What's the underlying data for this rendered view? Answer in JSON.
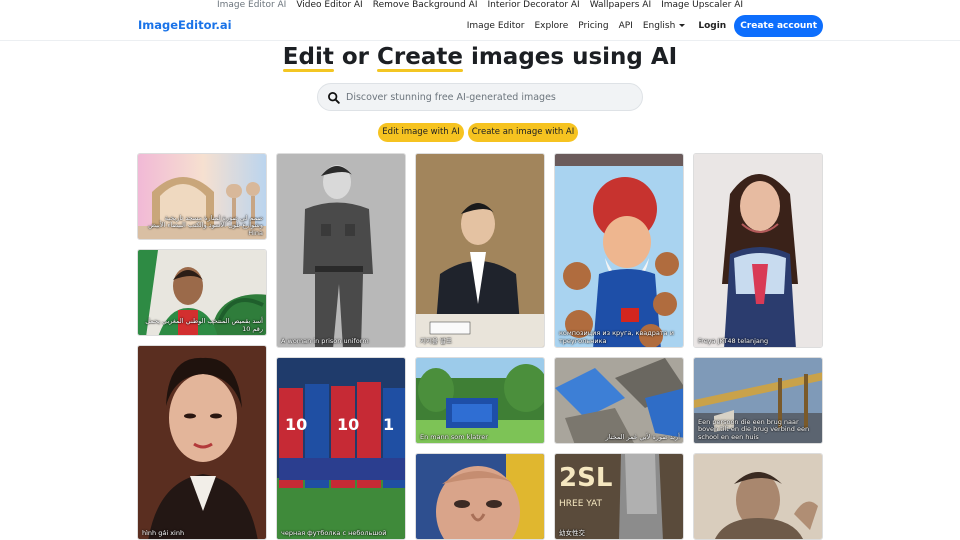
{
  "topbar": {
    "items": [
      "Image Editor AI",
      "Video Editor AI",
      "Remove Background AI",
      "Interior Decorator AI",
      "Wallpapers AI",
      "Image Upscaler AI"
    ]
  },
  "nav": {
    "brand": "ImageEditor.ai",
    "links": [
      "Image Editor",
      "Explore",
      "Pricing",
      "API"
    ],
    "language": "English",
    "login": "Login",
    "create_account": "Create account"
  },
  "hero": {
    "title_part1": "Edit",
    "title_part2": " or ",
    "title_part3": "Create",
    "title_part4": " images using AI"
  },
  "search": {
    "placeholder": "Discover stunning free AI-generated images"
  },
  "cta": {
    "edit": "Edit image with AI",
    "create": "Create an image with AI"
  },
  "gallery": {
    "captions": [
      "صمم لي صورة لمنارة مسجد تاريخية وشوارع بلون الأسود والكتب البيضاء الأبيض Hina",
      "أسد بقميص المنتخب الوطني المغربي يحمل رقم 10",
      "hình gái xinh",
      "A woman in prison uniform",
      "черная футболка с небольшой",
      "지지율 발표",
      "En mann som klatrer",
      "композиция из круга, квадрата и треугольника",
      "أريد صورة لأبي غمر المختار",
      "幼女性交",
      "Freya JKT48 telanjang",
      "Een persoon die een brug naar boven tilt en die brug verbind een school en een huis"
    ]
  },
  "colors": {
    "brand": "#1a73e8",
    "primary_button": "#0d6efd",
    "accent_yellow": "#f6c320"
  }
}
